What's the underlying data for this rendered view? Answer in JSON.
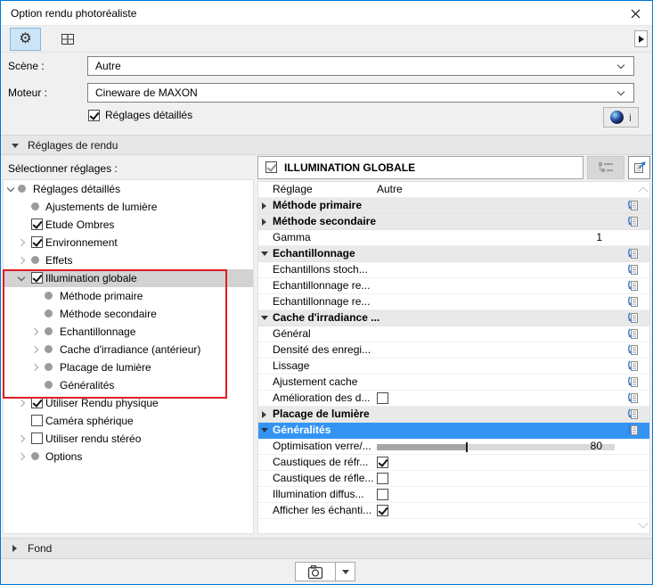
{
  "window": {
    "title": "Option rendu photoréaliste"
  },
  "fields": {
    "scene_label": "Scène :",
    "scene_value": "Autre",
    "engine_label": "Moteur :",
    "engine_value": "Cineware de MAXON",
    "detailed_settings_label": "Réglages détaillés",
    "detailed_settings_checked": true,
    "c4d_info_label": "i"
  },
  "sections": {
    "render_settings": "Réglages de rendu",
    "background": "Fond"
  },
  "tree": {
    "label": "Sélectionner réglages :",
    "items": [
      {
        "label": "Réglages détaillés",
        "level": 0,
        "expander": "expanded",
        "marker": "bullet"
      },
      {
        "label": "Ajustements de lumière",
        "level": 1,
        "expander": "none",
        "marker": "bullet"
      },
      {
        "label": "Etude Ombres",
        "level": 1,
        "expander": "none",
        "marker": "checked"
      },
      {
        "label": "Environnement",
        "level": 1,
        "expander": "collapsed",
        "marker": "checked"
      },
      {
        "label": "Effets",
        "level": 1,
        "expander": "collapsed",
        "marker": "bullet"
      },
      {
        "label": "Illumination globale",
        "level": 1,
        "expander": "expanded",
        "marker": "checked",
        "selected": true
      },
      {
        "label": "Méthode primaire",
        "level": 2,
        "expander": "none",
        "marker": "bullet"
      },
      {
        "label": "Méthode secondaire",
        "level": 2,
        "expander": "none",
        "marker": "bullet"
      },
      {
        "label": "Echantillonnage",
        "level": 2,
        "expander": "collapsed",
        "marker": "bullet"
      },
      {
        "label": "Cache d'irradiance (antérieur)",
        "level": 2,
        "expander": "collapsed",
        "marker": "bullet"
      },
      {
        "label": "Placage de lumière",
        "level": 2,
        "expander": "collapsed",
        "marker": "bullet"
      },
      {
        "label": "Généralités",
        "level": 2,
        "expander": "none",
        "marker": "bullet"
      },
      {
        "label": "Utiliser Rendu physique",
        "level": 1,
        "expander": "collapsed",
        "marker": "checked"
      },
      {
        "label": "Caméra sphérique",
        "level": 1,
        "expander": "none",
        "marker": "unchecked"
      },
      {
        "label": "Utiliser rendu stéréo",
        "level": 1,
        "expander": "collapsed",
        "marker": "unchecked"
      },
      {
        "label": "Options",
        "level": 1,
        "expander": "collapsed",
        "marker": "bullet"
      }
    ]
  },
  "panel": {
    "header": {
      "label": "ILLUMINATION GLOBALE",
      "checked": true
    },
    "rows": [
      {
        "label": "Réglage",
        "type": "plain",
        "control": "text",
        "value": "Autre"
      },
      {
        "label": "Méthode primaire",
        "type": "group",
        "expander": "collapsed",
        "icon": true
      },
      {
        "label": "Méthode secondaire",
        "type": "group",
        "expander": "collapsed",
        "icon": true
      },
      {
        "label": "Gamma",
        "type": "plain",
        "control": "num",
        "value": "1"
      },
      {
        "label": "Echantillonnage",
        "type": "group",
        "expander": "expanded",
        "icon": true
      },
      {
        "label": "Echantillons stoch...",
        "type": "plain",
        "icon": true
      },
      {
        "label": "Echantillonnage re...",
        "type": "plain",
        "icon": true
      },
      {
        "label": "Echantillonnage re...",
        "type": "plain",
        "icon": true
      },
      {
        "label": "Cache d'irradiance ...",
        "type": "group",
        "expander": "expanded",
        "icon": true
      },
      {
        "label": "Général",
        "type": "plain",
        "icon": true
      },
      {
        "label": "Densité des enregi...",
        "type": "plain",
        "icon": true
      },
      {
        "label": "Lissage",
        "type": "plain",
        "icon": true
      },
      {
        "label": "Ajustement cache",
        "type": "plain",
        "icon": true
      },
      {
        "label": "Amélioration des d...",
        "type": "plain",
        "control": "checkbox",
        "checked": false,
        "icon": true
      },
      {
        "label": "Placage de lumière",
        "type": "group",
        "expander": "collapsed",
        "icon": true
      },
      {
        "label": "Généralités",
        "type": "group",
        "expander": "expanded",
        "selected": true,
        "icon": true
      },
      {
        "label": "Optimisation verre/...",
        "type": "plain",
        "control": "slider",
        "value": "80",
        "fill_pct": 38
      },
      {
        "label": "Caustiques de réfr...",
        "type": "plain",
        "control": "checkbox",
        "checked": true
      },
      {
        "label": "Caustiques de réfle...",
        "type": "plain",
        "control": "checkbox",
        "checked": false
      },
      {
        "label": "Illumination diffus...",
        "type": "plain",
        "control": "checkbox",
        "checked": false
      },
      {
        "label": "Afficher les échanti...",
        "type": "plain",
        "control": "checkbox",
        "checked": true
      }
    ]
  },
  "colors": {
    "window_border": "#0078d7",
    "selection_blue": "#3494f4",
    "tree_selection_gray": "#d2d2d2",
    "annotation_red": "#e01b24",
    "selected_tool_bg": "#cbe4f6"
  },
  "annotation": {
    "type": "red-box",
    "target": "Illumination globale group"
  }
}
